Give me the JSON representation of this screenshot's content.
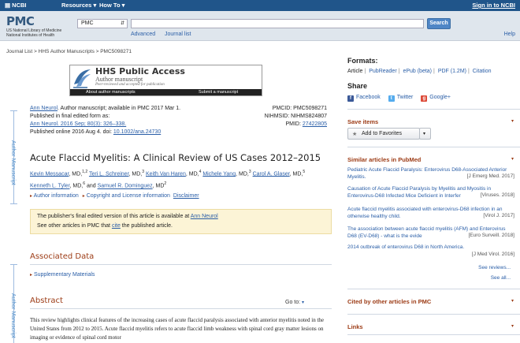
{
  "topbar": {
    "ncbi": "NCBI",
    "resources": "Resources",
    "howto": "How To",
    "signin": "Sign in to NCBI"
  },
  "header": {
    "logo": "PMC",
    "logo_sub1": "US National Library of Medicine",
    "logo_sub2": "National Institutes of Health",
    "db_selected": "PMC",
    "search_value": "",
    "search_button": "Search",
    "advanced": "Advanced",
    "journal_list": "Journal list",
    "help": "Help"
  },
  "breadcrumb": "Journal List > HHS Author Manuscripts > PMC5098271",
  "hhs_banner": {
    "title": "HHS Public Access",
    "subtitle": "Author manuscript",
    "note": "Peer-reviewed and accepted for publication",
    "about": "About author manuscripts",
    "submit": "Submit a manuscript"
  },
  "margin_labels": {
    "author_manuscript_1": "Author Manuscript",
    "author_manuscript_2": "Author Manuscript"
  },
  "citation": {
    "journal_link": "Ann Neurol",
    "line1_rest": ". Author manuscript; available in PMC 2017 Mar 1.",
    "line2": "Published in final edited form as:",
    "line3_link": "Ann Neurol. 2016 Sep; 80(3): 326–338.",
    "line4_pre": "Published online 2016 Aug 4. doi: ",
    "doi_link": "10.1002/ana.24730",
    "pmcid": "PMCID: PMC5098271",
    "nihmsid": "NIHMSID: NIHMS824807",
    "pmid_label": "PMID: ",
    "pmid_link": "27422805"
  },
  "article_title": "Acute Flaccid Myelitis: A Clinical Review of US Cases 2012–2015",
  "authors": [
    {
      "name": "Kevin Messacar",
      "suffix": ", MD,",
      "sup": "1,2"
    },
    {
      "name": "Teri L. Schreiner",
      "suffix": ", MD,",
      "sup": "3"
    },
    {
      "name": "Keith Van Haren",
      "suffix": ", MD,",
      "sup": "4"
    },
    {
      "name": "Michele Yang",
      "suffix": ", MD,",
      "sup": "3"
    },
    {
      "name": "Carol A. Glaser",
      "suffix": ", MD,",
      "sup": "5"
    },
    {
      "name": "Kenneth L. Tyler",
      "suffix": ", MD,",
      "sup": "6"
    },
    {
      "name": "Samuel R. Dominguez",
      "suffix": ", MD",
      "sup": "2"
    }
  ],
  "author_and": "and",
  "author_links": {
    "author_info": "Author information",
    "copyright": "Copyright and License information",
    "disclaimer": "Disclaimer"
  },
  "notice": {
    "line1_pre": "The publisher's final edited version of this article is available at ",
    "line1_link": "Ann Neurol",
    "line2_pre": "See other articles in PMC that ",
    "line2_link": "cite",
    "line2_post": " the published article."
  },
  "associated_data": {
    "heading": "Associated Data",
    "supplementary": "Supplementary Materials"
  },
  "abstract": {
    "heading": "Abstract",
    "goto": "Go to:",
    "text": "This review highlights clinical features of the increasing cases of acute flaccid paralysis associated with anterior myelitis noted in the United States from 2012 to 2015. Acute flaccid myelitis refers to acute flaccid limb weakness with spinal cord gray matter lesions on imaging or evidence of spinal cord motor"
  },
  "right": {
    "formats_h": "Formats:",
    "formats": [
      "Article",
      "PubReader",
      "ePub (beta)",
      "PDF (1.2M)",
      "Citation"
    ],
    "share_h": "Share",
    "facebook": "Facebook",
    "twitter": "Twitter",
    "google": "Google+",
    "save_items": "Save items",
    "add_fav": "Add to Favorites",
    "similar_h": "Similar articles in PubMed",
    "similar": [
      {
        "title": "Pediatric Acute Flaccid Paralysis: Enterovirus D68-Associated Anterior Myelitis.",
        "src": "[J Emerg Med. 2017]"
      },
      {
        "title": "Causation of Acute Flaccid Paralysis by Myelitis and Myositis in Enterovirus-D68 Infected Mice Deficient in Interfer",
        "src": "[Viruses. 2018]"
      },
      {
        "title": "Acute flaccid myelitis associated with enterovirus-D68 infection in an otherwise healthy child.",
        "src": "[Virol J. 2017]"
      },
      {
        "title": "The association between acute flaccid myelitis (AFM) and Enterovirus D68 (EV-D68) - what is the evide",
        "src": "[Euro Surveill. 2018]"
      },
      {
        "title": "2014 outbreak of enterovirus D68 in North America.",
        "src": "[J Med Virol. 2016]"
      }
    ],
    "see_reviews": "See reviews...",
    "see_all": "See all...",
    "cited_h": "Cited by other articles in PMC",
    "links_h": "Links"
  }
}
